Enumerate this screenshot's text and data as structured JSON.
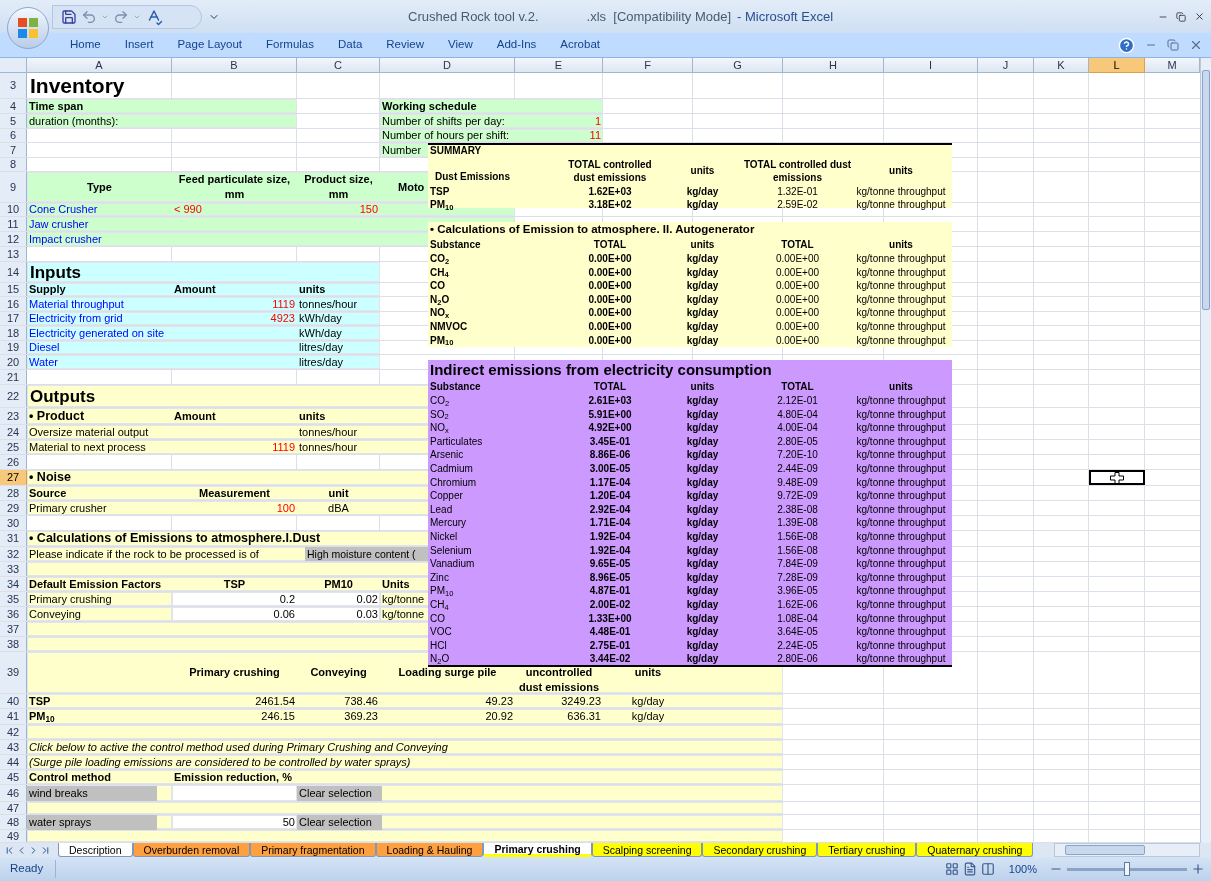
{
  "title": {
    "file": "Crushed Rock tool v.2.",
    "ext": ".xls  [Compatibility Mode]",
    "app": "- Microsoft Excel"
  },
  "ribbon_tabs": [
    "Home",
    "Insert",
    "Page Layout",
    "Formulas",
    "Data",
    "Review",
    "View",
    "Add-Ins",
    "Acrobat"
  ],
  "sheet": {
    "columns": [
      {
        "label": "A",
        "selected": false
      },
      {
        "label": "B",
        "selected": false
      },
      {
        "label": "C",
        "selected": false
      },
      {
        "label": "D",
        "selected": false
      },
      {
        "label": "E",
        "selected": false
      },
      {
        "label": "F",
        "selected": false
      },
      {
        "label": "G",
        "selected": false
      },
      {
        "label": "H",
        "selected": false
      },
      {
        "label": "I",
        "selected": false
      },
      {
        "label": "J",
        "selected": false
      },
      {
        "label": "K",
        "selected": false
      },
      {
        "label": "L",
        "selected": true
      },
      {
        "label": "M",
        "selected": false
      }
    ],
    "rows": [
      {
        "n": "3",
        "selected": false,
        "cells": {
          "A": {
            "kind": "title",
            "text": "Inventory"
          }
        }
      },
      {
        "n": "4",
        "selected": false,
        "fill": {
          "A-B": {
            "color": "#ccffcc"
          },
          "D-E": {
            "color": "#ccffcc"
          }
        },
        "cells": {
          "A": {
            "kind": "bold",
            "text": "Time span"
          },
          "D": {
            "kind": "bold",
            "text": "Working schedule"
          }
        }
      },
      {
        "n": "5",
        "selected": false,
        "fill": {
          "A-B": {
            "color": "#ccffcc"
          },
          "D-E": {
            "color": "#ccffcc"
          }
        },
        "cells": {
          "A": {
            "kind": "text",
            "text": "duration (months):"
          },
          "D": {
            "kind": "text",
            "text": "Number of shifts per day:"
          },
          "E": {
            "kind": "input",
            "text": "1"
          }
        }
      },
      {
        "n": "6",
        "selected": false,
        "fill": {
          "D-E": {
            "color": "#ccffcc"
          }
        },
        "cells": {
          "D": {
            "kind": "text",
            "text": "Number of hours per shift:"
          },
          "E": {
            "kind": "input",
            "text": "11"
          }
        }
      },
      {
        "n": "7",
        "selected": false,
        "fill": {
          "D-D": {
            "color": "#ccffcc"
          }
        },
        "cells": {
          "D": {
            "kind": "text",
            "text": "Number"
          }
        }
      },
      {
        "n": "8",
        "selected": false
      },
      {
        "n": "9",
        "selected": false,
        "fill": {
          "A-D": {
            "color": "#ccffcc"
          }
        },
        "cells": {
          "A": {
            "kind": "head",
            "text": "Type"
          },
          "B": {
            "kind": "head",
            "text": "Feed particulate size, mm"
          },
          "C": {
            "kind": "head",
            "text": "Product size, mm"
          },
          "D": {
            "kind": "headcut",
            "text": "Moto"
          }
        }
      },
      {
        "n": "10",
        "selected": false,
        "fill": {
          "A-D": {
            "color": "#ccffcc"
          }
        },
        "cells": {
          "A": {
            "kind": "link",
            "text": "Cone Crusher"
          },
          "B": {
            "kind": "inputleft",
            "text": "< 990"
          },
          "C": {
            "kind": "input",
            "text": "150"
          }
        }
      },
      {
        "n": "11",
        "selected": false,
        "fill": {
          "A-D": {
            "color": "#ccffcc"
          }
        },
        "cells": {
          "A": {
            "kind": "link",
            "text": "Jaw crusher"
          }
        }
      },
      {
        "n": "12",
        "selected": false,
        "fill": {
          "A-D": {
            "color": "#ccffcc"
          }
        },
        "cells": {
          "A": {
            "kind": "link",
            "text": "Impact crusher"
          }
        }
      },
      {
        "n": "13",
        "selected": false
      },
      {
        "n": "14",
        "selected": false,
        "fill": {
          "A-C": {
            "color": "#ccffff"
          }
        },
        "cells": {
          "A": {
            "kind": "section",
            "text": "Inputs"
          }
        }
      },
      {
        "n": "15",
        "selected": false,
        "fill": {
          "A-C": {
            "color": "#ccffff"
          }
        },
        "cells": {
          "A": {
            "kind": "bold",
            "text": "Supply"
          },
          "B": {
            "kind": "bold",
            "text": "Amount"
          },
          "C": {
            "kind": "bold",
            "text": "units"
          }
        }
      },
      {
        "n": "16",
        "selected": false,
        "fill": {
          "A-C": {
            "color": "#ccffff"
          }
        },
        "cells": {
          "A": {
            "kind": "link",
            "text": "Material throughput"
          },
          "B": {
            "kind": "input",
            "text": "1119"
          },
          "C": {
            "kind": "text",
            "text": "tonnes/hour"
          }
        }
      },
      {
        "n": "17",
        "selected": false,
        "fill": {
          "A-C": {
            "color": "#ccffff"
          }
        },
        "cells": {
          "A": {
            "kind": "link",
            "text": "Electricity from grid"
          },
          "B": {
            "kind": "input",
            "text": "4923"
          },
          "C": {
            "kind": "text",
            "text": "kWh/day"
          }
        }
      },
      {
        "n": "18",
        "selected": false,
        "fill": {
          "A-C": {
            "color": "#ccffff"
          }
        },
        "cells": {
          "A": {
            "kind": "link",
            "text": "Electricity generated on site"
          },
          "C": {
            "kind": "text",
            "text": "kWh/day"
          }
        }
      },
      {
        "n": "19",
        "selected": false,
        "fill": {
          "A-C": {
            "color": "#ccffff"
          }
        },
        "cells": {
          "A": {
            "kind": "link",
            "text": "Diesel"
          },
          "C": {
            "kind": "text",
            "text": "litres/day"
          }
        }
      },
      {
        "n": "20",
        "selected": false,
        "fill": {
          "A-C": {
            "color": "#ccffff"
          }
        },
        "cells": {
          "A": {
            "kind": "link",
            "text": "Water"
          },
          "C": {
            "kind": "text",
            "text": "litres/day"
          }
        }
      },
      {
        "n": "21",
        "selected": false
      },
      {
        "n": "22",
        "selected": false,
        "fill": {
          "A-D": {
            "color": "#ffffcc"
          }
        },
        "cells": {
          "A": {
            "kind": "section",
            "text": "Outputs"
          }
        }
      },
      {
        "n": "23",
        "selected": false,
        "fill": {
          "A-D": {
            "color": "#ffffcc"
          }
        },
        "cells": {
          "A": {
            "kind": "subsection",
            "text": "• Product"
          },
          "B": {
            "kind": "bold",
            "text": "Amount"
          },
          "C": {
            "kind": "bold",
            "text": "units"
          }
        }
      },
      {
        "n": "24",
        "selected": false,
        "fill": {
          "A-D": {
            "color": "#ffffcc"
          }
        },
        "cells": {
          "A": {
            "kind": "text",
            "text": "Oversize material output"
          },
          "C": {
            "kind": "text",
            "text": "tonnes/hour"
          }
        }
      },
      {
        "n": "25",
        "selected": false,
        "fill": {
          "A-D": {
            "color": "#ffffcc"
          }
        },
        "cells": {
          "A": {
            "kind": "text",
            "text": "Material to next process"
          },
          "B": {
            "kind": "input",
            "text": "1119"
          },
          "C": {
            "kind": "text",
            "text": "tonnes/hour"
          }
        }
      },
      {
        "n": "26",
        "selected": false
      },
      {
        "n": "27",
        "selected": true,
        "fill": {
          "A-D": {
            "color": "#ffffcc"
          }
        },
        "cells": {
          "A": {
            "kind": "subsection",
            "text": "• Noise"
          }
        }
      },
      {
        "n": "28",
        "selected": false,
        "fill": {
          "A-D": {
            "color": "#ffffcc"
          }
        },
        "cells": {
          "A": {
            "kind": "bold",
            "text": "Source"
          },
          "B": {
            "kind": "boldcenter",
            "text": "Measurement"
          },
          "C": {
            "kind": "boldcenter",
            "text": "unit"
          }
        }
      },
      {
        "n": "29",
        "selected": false,
        "fill": {
          "A-D": {
            "color": "#ffffcc"
          }
        },
        "cells": {
          "A": {
            "kind": "text",
            "text": "Primary crusher"
          },
          "B": {
            "kind": "input",
            "text": "100"
          },
          "C": {
            "kind": "center",
            "text": "dBA"
          }
        }
      },
      {
        "n": "30",
        "selected": false
      },
      {
        "n": "31",
        "selected": false,
        "fill": {
          "A-D": {
            "color": "#ffffcc"
          }
        },
        "cells": {
          "A": {
            "kind": "subsection",
            "text": "• Calculations of Emissions to atmosphere.I.Dust"
          }
        }
      },
      {
        "n": "32",
        "selected": false,
        "fill": {
          "A-D": {
            "color": "#ffffcc"
          }
        },
        "cells": {
          "A": {
            "kind": "text",
            "text": "Please indicate if the rock to be processed is of"
          },
          "C": {
            "kind": "dropdown",
            "text": "High moisture content ("
          }
        }
      },
      {
        "n": "33",
        "selected": false,
        "fill": {
          "A-D": {
            "color": "#ffffcc"
          }
        }
      },
      {
        "n": "34",
        "selected": false,
        "fill": {
          "A-D": {
            "color": "#ffffcc"
          }
        },
        "cells": {
          "A": {
            "kind": "bold",
            "text": "Default Emission Factors"
          },
          "B": {
            "kind": "boldcenter",
            "text": "TSP"
          },
          "C": {
            "kind": "boldcenter",
            "text": "PM10"
          },
          "D": {
            "kind": "bold",
            "text": "Units"
          }
        }
      },
      {
        "n": "35",
        "selected": false,
        "fill": {
          "A-A": {
            "color": "#ffffcc"
          },
          "B-C": {
            "color": "#ffffff"
          },
          "D-D": {
            "color": "#ffffcc"
          }
        },
        "cells": {
          "A": {
            "kind": "text",
            "text": "Primary crushing"
          },
          "B": {
            "kind": "value",
            "text": "0.2"
          },
          "C": {
            "kind": "value",
            "text": "0.02"
          },
          "D": {
            "kind": "text",
            "text": "kg/tonne"
          }
        }
      },
      {
        "n": "36",
        "selected": false,
        "fill": {
          "A-A": {
            "color": "#ffffcc"
          },
          "B-C": {
            "color": "#ffffff"
          },
          "D-D": {
            "color": "#ffffcc"
          }
        },
        "cells": {
          "A": {
            "kind": "text",
            "text": "Conveying"
          },
          "B": {
            "kind": "value",
            "text": "0.06"
          },
          "C": {
            "kind": "value",
            "text": "0.03"
          },
          "D": {
            "kind": "text",
            "text": "kg/tonne"
          }
        }
      },
      {
        "n": "37",
        "selected": false,
        "fill": {
          "A-D": {
            "color": "#ffffcc"
          }
        }
      },
      {
        "n": "38",
        "selected": false,
        "fill": {
          "A-D": {
            "color": "#ffffcc"
          }
        }
      },
      {
        "n": "39",
        "selected": false,
        "fill": {
          "A-G": {
            "color": "#ffffcc"
          }
        },
        "cells": {
          "B": {
            "kind": "colhead",
            "text": "Primary crushing"
          },
          "C": {
            "kind": "colhead",
            "text": "Conveying"
          },
          "D": {
            "kind": "colhead",
            "text": "Loading surge pile"
          },
          "E": {
            "kind": "colhead",
            "text": "uncontrolled dust emissions"
          },
          "F": {
            "kind": "colhead",
            "text": "units"
          }
        }
      },
      {
        "n": "40",
        "selected": false,
        "fill": {
          "A-G": {
            "color": "#ffffcc"
          }
        },
        "cells": {
          "A": {
            "kind": "bold",
            "text": "TSP"
          },
          "B": {
            "kind": "value",
            "text": "2461.54"
          },
          "C": {
            "kind": "value",
            "text": "738.46"
          },
          "D": {
            "kind": "value",
            "text": "49.23"
          },
          "E": {
            "kind": "value",
            "text": "3249.23"
          },
          "F": {
            "kind": "center",
            "text": "kg/day"
          }
        }
      },
      {
        "n": "41",
        "selected": false,
        "fill": {
          "A-G": {
            "color": "#ffffcc"
          }
        },
        "cells": {
          "A": {
            "kind": "bold",
            "text": "PM$_{10}$"
          },
          "B": {
            "kind": "value",
            "text": "246.15"
          },
          "C": {
            "kind": "value",
            "text": "369.23"
          },
          "D": {
            "kind": "value",
            "text": "20.92"
          },
          "E": {
            "kind": "value",
            "text": "636.31"
          },
          "F": {
            "kind": "center",
            "text": "kg/day"
          }
        }
      },
      {
        "n": "42",
        "selected": false,
        "fill": {
          "A-G": {
            "color": "#ffffcc"
          }
        }
      },
      {
        "n": "43",
        "selected": false,
        "fill": {
          "A-G": {
            "color": "#ffffcc"
          }
        },
        "cells": {
          "A": {
            "kind": "italic",
            "text": "Click below to active the control method used during Primary Crushing and Conveying"
          }
        }
      },
      {
        "n": "44",
        "selected": false,
        "fill": {
          "A-G": {
            "color": "#ffffcc"
          }
        },
        "cells": {
          "A": {
            "kind": "italic",
            "text": "(Surge pile loading emissions are considered to be controlled by water sprays)"
          }
        }
      },
      {
        "n": "45",
        "selected": false,
        "fill": {
          "A-G": {
            "color": "#ffffcc"
          }
        },
        "cells": {
          "A": {
            "kind": "bold",
            "text": "Control method"
          },
          "B": {
            "kind": "bold",
            "text": "Emission reduction, %"
          }
        }
      },
      {
        "n": "46",
        "selected": false,
        "fill": {
          "A-A": {
            "color": "#ffffcc"
          },
          "B-B": {
            "color": "#ffffff"
          },
          "C-G": {
            "color": "#ffffcc"
          }
        },
        "cells": {
          "A": {
            "kind": "option",
            "text": "wind breaks"
          },
          "C": {
            "kind": "button",
            "text": "Clear selection"
          }
        }
      },
      {
        "n": "47",
        "selected": false,
        "fill": {
          "A-G": {
            "color": "#ffffcc"
          }
        }
      },
      {
        "n": "48",
        "selected": false,
        "fill": {
          "A-A": {
            "color": "#ffffcc"
          },
          "B-B": {
            "color": "#ffffff"
          },
          "C-G": {
            "color": "#ffffcc"
          }
        },
        "cells": {
          "A": {
            "kind": "option",
            "text": "water sprays"
          },
          "B": {
            "kind": "value",
            "text": "50"
          },
          "C": {
            "kind": "button",
            "text": "Clear selection"
          }
        }
      },
      {
        "n": "49",
        "selected": false,
        "fill": {
          "A-G": {
            "color": "#ffffcc"
          }
        }
      }
    ]
  },
  "summary": {
    "title": "SUMMARY",
    "columns": [
      "Dust Emissions",
      "TOTAL controlled dust emissions",
      "units",
      "TOTAL controlled dust emissions",
      "units"
    ],
    "rows": [
      [
        "TSP",
        "1.62E+03",
        "kg/day",
        "1.32E-01",
        "kg/tonne throughput"
      ],
      [
        "PM$_{10}$",
        "3.18E+02",
        "kg/day",
        "2.59E-02",
        "kg/tonne throughput"
      ]
    ]
  },
  "autogenerator": {
    "title": "• Calculations of Emission to atmosphere. II. Autogenerator",
    "columns": [
      "Substance",
      "TOTAL",
      "units",
      "TOTAL",
      "units"
    ],
    "rows": [
      [
        "CO$_{2}$",
        "0.00E+00",
        "kg/day",
        "0.00E+00",
        "kg/tonne throughput"
      ],
      [
        "CH$_{4}$",
        "0.00E+00",
        "kg/day",
        "0.00E+00",
        "kg/tonne throughput"
      ],
      [
        "CO",
        "0.00E+00",
        "kg/day",
        "0.00E+00",
        "kg/tonne throughput"
      ],
      [
        "N$_{2}$O",
        "0.00E+00",
        "kg/day",
        "0.00E+00",
        "kg/tonne throughput"
      ],
      [
        "NO$_{x}$",
        "0.00E+00",
        "kg/day",
        "0.00E+00",
        "kg/tonne throughput"
      ],
      [
        "NMVOC",
        "0.00E+00",
        "kg/day",
        "0.00E+00",
        "kg/tonne throughput"
      ],
      [
        "PM$_{10}$",
        "0.00E+00",
        "kg/day",
        "0.00E+00",
        "kg/tonne throughput"
      ]
    ]
  },
  "indirect": {
    "title": "Indirect emissions from electricity consumption",
    "columns": [
      "Substance",
      "TOTAL",
      "units",
      "TOTAL",
      "units"
    ],
    "rows": [
      [
        "CO$_{2}$",
        "2.61E+03",
        "kg/day",
        "2.12E-01",
        "kg/tonne throughput"
      ],
      [
        "SO$_{2}$",
        "5.91E+00",
        "kg/day",
        "4.80E-04",
        "kg/tonne throughput"
      ],
      [
        "NO$_{x}$",
        "4.92E+00",
        "kg/day",
        "4.00E-04",
        "kg/tonne throughput"
      ],
      [
        "Particulates",
        "3.45E-01",
        "kg/day",
        "2.80E-05",
        "kg/tonne throughput"
      ],
      [
        "Arsenic",
        "8.86E-06",
        "kg/day",
        "7.20E-10",
        "kg/tonne throughput"
      ],
      [
        "Cadmium",
        "3.00E-05",
        "kg/day",
        "2.44E-09",
        "kg/tonne throughput"
      ],
      [
        "Chromium",
        "1.17E-04",
        "kg/day",
        "9.48E-09",
        "kg/tonne throughput"
      ],
      [
        "Copper",
        "1.20E-04",
        "kg/day",
        "9.72E-09",
        "kg/tonne throughput"
      ],
      [
        "Lead",
        "2.92E-04",
        "kg/day",
        "2.38E-08",
        "kg/tonne throughput"
      ],
      [
        "Mercury",
        "1.71E-04",
        "kg/day",
        "1.39E-08",
        "kg/tonne throughput"
      ],
      [
        "Nickel",
        "1.92E-04",
        "kg/day",
        "1.56E-08",
        "kg/tonne throughput"
      ],
      [
        "Selenium",
        "1.92E-04",
        "kg/day",
        "1.56E-08",
        "kg/tonne throughput"
      ],
      [
        "Vanadium",
        "9.65E-05",
        "kg/day",
        "7.84E-09",
        "kg/tonne throughput"
      ],
      [
        "Zinc",
        "8.96E-05",
        "kg/day",
        "7.28E-09",
        "kg/tonne throughput"
      ],
      [
        "PM$_{10}$",
        "4.87E-01",
        "kg/day",
        "3.96E-05",
        "kg/tonne throughput"
      ],
      [
        "CH$_{4}$",
        "2.00E-02",
        "kg/day",
        "1.62E-06",
        "kg/tonne throughput"
      ],
      [
        "CO",
        "1.33E+00",
        "kg/day",
        "1.08E-04",
        "kg/tonne throughput"
      ],
      [
        "VOC",
        "4.48E-01",
        "kg/day",
        "3.64E-05",
        "kg/tonne throughput"
      ],
      [
        "HCl",
        "2.75E-01",
        "kg/day",
        "2.24E-05",
        "kg/tonne throughput"
      ],
      [
        "N$_{2}$O",
        "3.44E-02",
        "kg/day",
        "2.80E-06",
        "kg/tonne throughput"
      ]
    ]
  },
  "sheet_tabs": [
    {
      "label": "Description",
      "selected": false,
      "color": "#ffffff"
    },
    {
      "label": "Overburden removal",
      "selected": false,
      "color": "#ffa040"
    },
    {
      "label": "Primary fragmentation",
      "selected": false,
      "color": "#ffa040"
    },
    {
      "label": "Loading & Hauling",
      "selected": false,
      "color": "#ffa040"
    },
    {
      "label": "Primary crushing",
      "selected": true,
      "color": "#ffff00"
    },
    {
      "label": "Scalping screening",
      "selected": false,
      "color": "#ffff00"
    },
    {
      "label": "Secondary crushing",
      "selected": false,
      "color": "#ffff00"
    },
    {
      "label": "Tertiary crushing",
      "selected": false,
      "color": "#ffff00"
    },
    {
      "label": "Quaternary crushing",
      "selected": false,
      "color": "#ffff00"
    }
  ],
  "status_bar": {
    "text": "Ready",
    "zoom": {
      "label": "100%",
      "level": 0.5
    }
  }
}
